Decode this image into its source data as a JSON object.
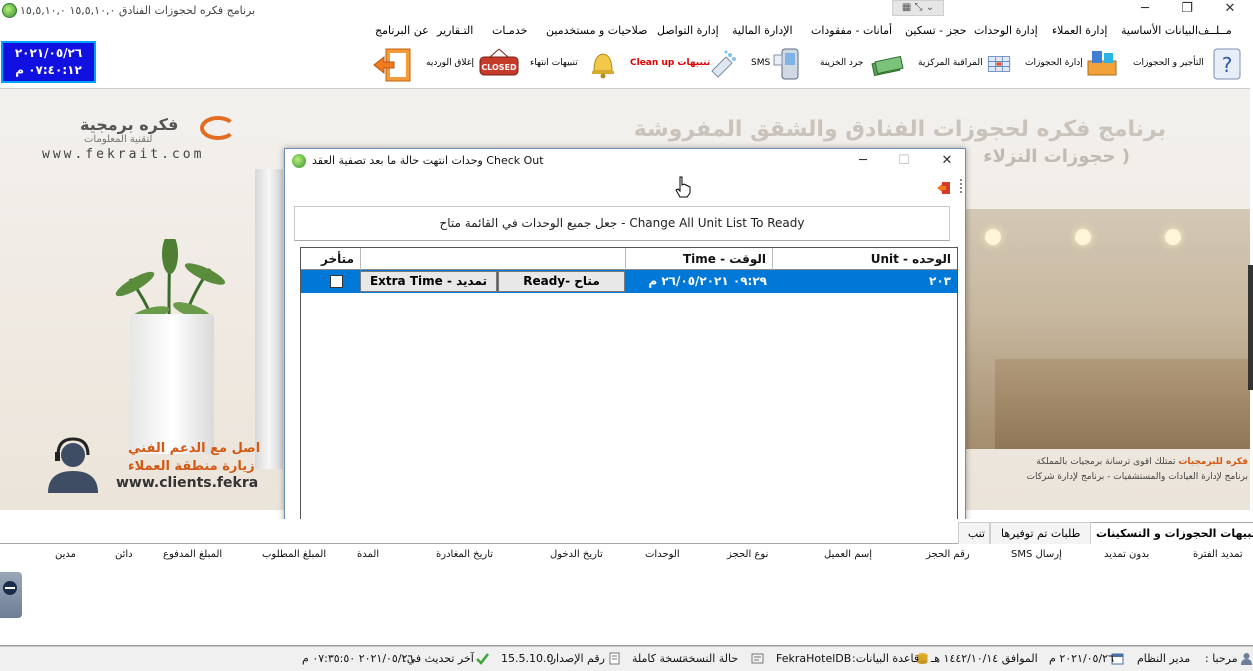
{
  "window": {
    "title": "برنامج فكره لحجوزات الفنادق ١٥,٥,١٠,٠ ١٥,٥,١٠,٠",
    "minimize": "─",
    "restore": "❐",
    "close": "✕",
    "quick_access": "▦ ⤡ ⌄"
  },
  "menu": {
    "file": "مــلــف",
    "basic_data": "البيانات الأساسية",
    "clients": "إدارة العملاء",
    "units": "إدارة الوحدات",
    "booking": "حجز - تسكين",
    "deposits": "أمانات - مفقودات",
    "finance": "الإدارة المالية",
    "communication": "إدارة التواصل",
    "permissions": "صلاحيات و مستخدمين",
    "services": "خدمـات",
    "reports": "التـقارير",
    "about": "عن البرنامج"
  },
  "clock": {
    "date": "٢٠٢١/٠٥/٢٦",
    "time": "٠٧:٤٠:١٢ م"
  },
  "toolbar": {
    "help_icon": "?",
    "rent_booking": "التأجير و الحجوزات",
    "manage_bookings": "إدارة الحجوزات",
    "central_monitor": "المراقبة المركزية",
    "treasury": "جرد الخزينة",
    "sms": "SMS",
    "cleanup_alerts_red": "تنبيهات Clean up",
    "end_alerts": "تنبيهات انتهاء",
    "close_shift": "إغلاق الورديه",
    "closed_sign": "CLOSED"
  },
  "background": {
    "title": "برنامج فكره لحجوزات الفنادق والشقق المفروشة",
    "subtitle": "( حجوزات النزلاء",
    "logo_name": "فكره برمجية",
    "logo_sub": "لتقنية المعلومات",
    "website": "www.fekrait.com",
    "support_line1": "اصل مع الدعم الفني",
    "support_line2": "زيارة منطقة العملاء",
    "clients_site": "www.clients.fekra",
    "right_text_brand": "فكره للبرمجيات",
    "right_text1": "تمتلك أقوى ترسانة برمجيات بالمملكة",
    "right_text2": "برنامج لإدارة العيادات والمستشفيات - برنامج لإدارة شركات"
  },
  "dialog": {
    "title": "وحدات انتهت حالة ما بعد تصفية العقد Check Out",
    "minimize": "─",
    "maximize": "☐",
    "close": "✕",
    "change_all_button": "جعل جميع الوحدات في القائمة متاح - Change All Unit List To Ready",
    "columns": {
      "unit": "الوحده - Unit",
      "time": "الوقت - Time",
      "late": "متأخر"
    },
    "rows": [
      {
        "unit": "٢٠٣",
        "time": "٠٩:٢٩ ٢٦/٠٥/٢٠٢١ م",
        "ready_button": "Ready- متاح",
        "extra_time_button": "Extra Time - تمديد",
        "late": false
      }
    ]
  },
  "bottom_tabs": {
    "active": "تنبيهات الحجوزات و التسكينات",
    "second": "طلبات تم توفيرها",
    "third": "تنب"
  },
  "bottom_grid": {
    "headers": [
      "تمديد الفترة",
      "بدون تمديد",
      "إرسال SMS",
      "رقم الحجز",
      "إسم العميل",
      "نوع الحجز",
      "الوحدات",
      "تاريخ الدخول",
      "تاريخ المغادرة",
      "المدة",
      "المبلغ المطلوب",
      "المبلغ المدفوع",
      "دائن",
      "مدين"
    ]
  },
  "statusbar": {
    "welcome": "مرحبا :",
    "user": "مدير النظام",
    "date": "٢٠٢١/٠٥/٢٦ م",
    "hijri": "الموافق ١٤٤٢/١٠/١٤ هـ",
    "db_label": "قاعدة البيانات:",
    "db_name": "FekraHotelDB",
    "copy_label": "حالة النسخة:",
    "copy_value": "نسخة كاملة",
    "version_label": "رقم الإصدار:",
    "version": "15.5.10.0",
    "last_update_label": "آخر تحديث في:",
    "last_update": "٢٠٢١/٠٥/٢٦ ٠٧:٣٥:٥٠ م"
  },
  "colors": {
    "selection": "#0078d7",
    "clock_bg": "#1010e0",
    "accent_orange": "#e36b22",
    "cleanup_red": "#e00000"
  }
}
